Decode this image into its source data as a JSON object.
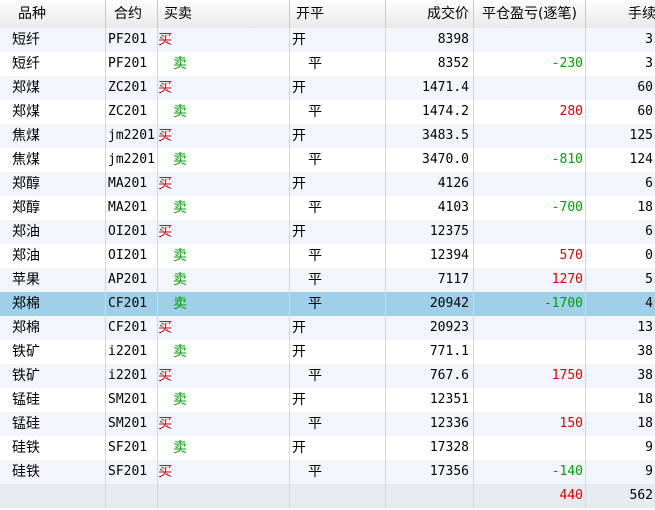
{
  "columns": [
    "品种",
    "合约",
    "买卖",
    "开平",
    "成交价",
    "平仓盈亏(逐笔)",
    "手续"
  ],
  "colors": {
    "buy": "#e00000",
    "sell": "#00a000",
    "profit": "#e00000",
    "loss": "#00a000",
    "selected": "#9fcfe9"
  },
  "rows": [
    {
      "name": "短纤",
      "contract": "PF201",
      "side": "买",
      "oc": "开",
      "price": "8398",
      "pnl": "",
      "fee": "3"
    },
    {
      "name": "短纤",
      "contract": "PF201",
      "side": "卖",
      "oc": "平",
      "price": "8352",
      "pnl": "-230",
      "fee": "3"
    },
    {
      "name": "郑煤",
      "contract": "ZC201",
      "side": "买",
      "oc": "开",
      "price": "1471.4",
      "pnl": "",
      "fee": "60"
    },
    {
      "name": "郑煤",
      "contract": "ZC201",
      "side": "卖",
      "oc": "平",
      "price": "1474.2",
      "pnl": "280",
      "fee": "60"
    },
    {
      "name": "焦煤",
      "contract": "jm2201",
      "side": "买",
      "oc": "开",
      "price": "3483.5",
      "pnl": "",
      "fee": "125"
    },
    {
      "name": "焦煤",
      "contract": "jm2201",
      "side": "卖",
      "oc": "平",
      "price": "3470.0",
      "pnl": "-810",
      "fee": "124"
    },
    {
      "name": "郑醇",
      "contract": "MA201",
      "side": "买",
      "oc": "开",
      "price": "4126",
      "pnl": "",
      "fee": "6"
    },
    {
      "name": "郑醇",
      "contract": "MA201",
      "side": "卖",
      "oc": "平",
      "price": "4103",
      "pnl": "-700",
      "fee": "18"
    },
    {
      "name": "郑油",
      "contract": "OI201",
      "side": "买",
      "oc": "开",
      "price": "12375",
      "pnl": "",
      "fee": "6"
    },
    {
      "name": "郑油",
      "contract": "OI201",
      "side": "卖",
      "oc": "平",
      "price": "12394",
      "pnl": "570",
      "fee": "0"
    },
    {
      "name": "苹果",
      "contract": "AP201",
      "side": "卖",
      "oc": "平",
      "price": "7117",
      "pnl": "1270",
      "fee": "5"
    },
    {
      "name": "郑棉",
      "contract": "CF201",
      "side": "卖",
      "oc": "平",
      "price": "20942",
      "pnl": "-1700",
      "fee": "4",
      "selected": true
    },
    {
      "name": "郑棉",
      "contract": "CF201",
      "side": "买",
      "oc": "开",
      "price": "20923",
      "pnl": "",
      "fee": "13"
    },
    {
      "name": "铁矿",
      "contract": "i2201",
      "side": "卖",
      "oc": "开",
      "price": "771.1",
      "pnl": "",
      "fee": "38"
    },
    {
      "name": "铁矿",
      "contract": "i2201",
      "side": "买",
      "oc": "平",
      "price": "767.6",
      "pnl": "1750",
      "fee": "38"
    },
    {
      "name": "锰硅",
      "contract": "SM201",
      "side": "卖",
      "oc": "开",
      "price": "12351",
      "pnl": "",
      "fee": "18"
    },
    {
      "name": "锰硅",
      "contract": "SM201",
      "side": "买",
      "oc": "平",
      "price": "12336",
      "pnl": "150",
      "fee": "18"
    },
    {
      "name": "硅铁",
      "contract": "SF201",
      "side": "卖",
      "oc": "开",
      "price": "17328",
      "pnl": "",
      "fee": "9"
    },
    {
      "name": "硅铁",
      "contract": "SF201",
      "side": "买",
      "oc": "平",
      "price": "17356",
      "pnl": "-140",
      "fee": "9"
    }
  ],
  "totals": {
    "pnl": "440",
    "fee": "562"
  }
}
